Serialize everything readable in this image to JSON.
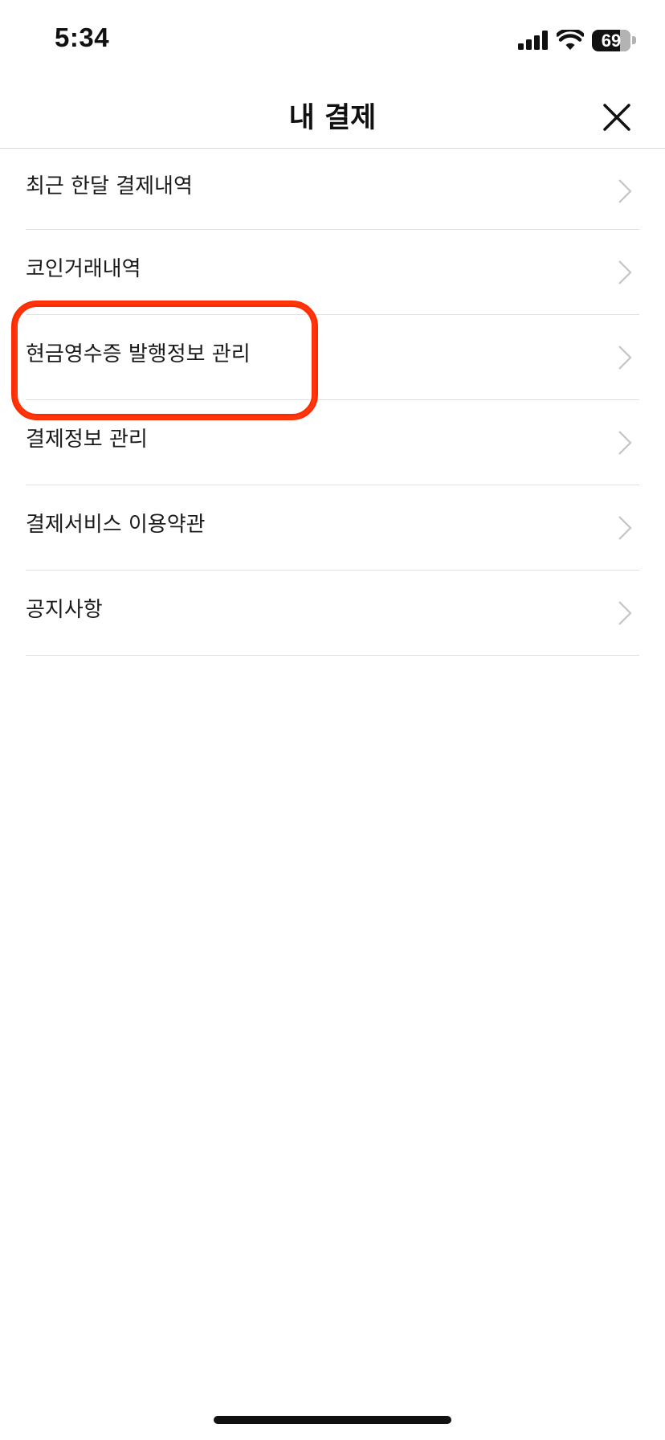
{
  "status_bar": {
    "time": "5:34",
    "battery_level": "69",
    "icons": [
      "cellular-signal-icon",
      "wifi-icon",
      "battery-icon"
    ]
  },
  "header": {
    "title": "내 결제",
    "close_icon": "close-icon"
  },
  "menu": {
    "items": [
      {
        "label": "최근 한달 결제내역"
      },
      {
        "label": "코인거래내역"
      },
      {
        "label": "현금영수증 발행정보 관리",
        "highlighted": true
      },
      {
        "label": "결제정보 관리"
      },
      {
        "label": "결제서비스 이용약관"
      },
      {
        "label": "공지사항"
      }
    ]
  },
  "colors": {
    "annotation": "#ff2a00",
    "divider": "#e0e0e0",
    "chevron": "#c4c4c4",
    "text": "#1a1a1a"
  }
}
